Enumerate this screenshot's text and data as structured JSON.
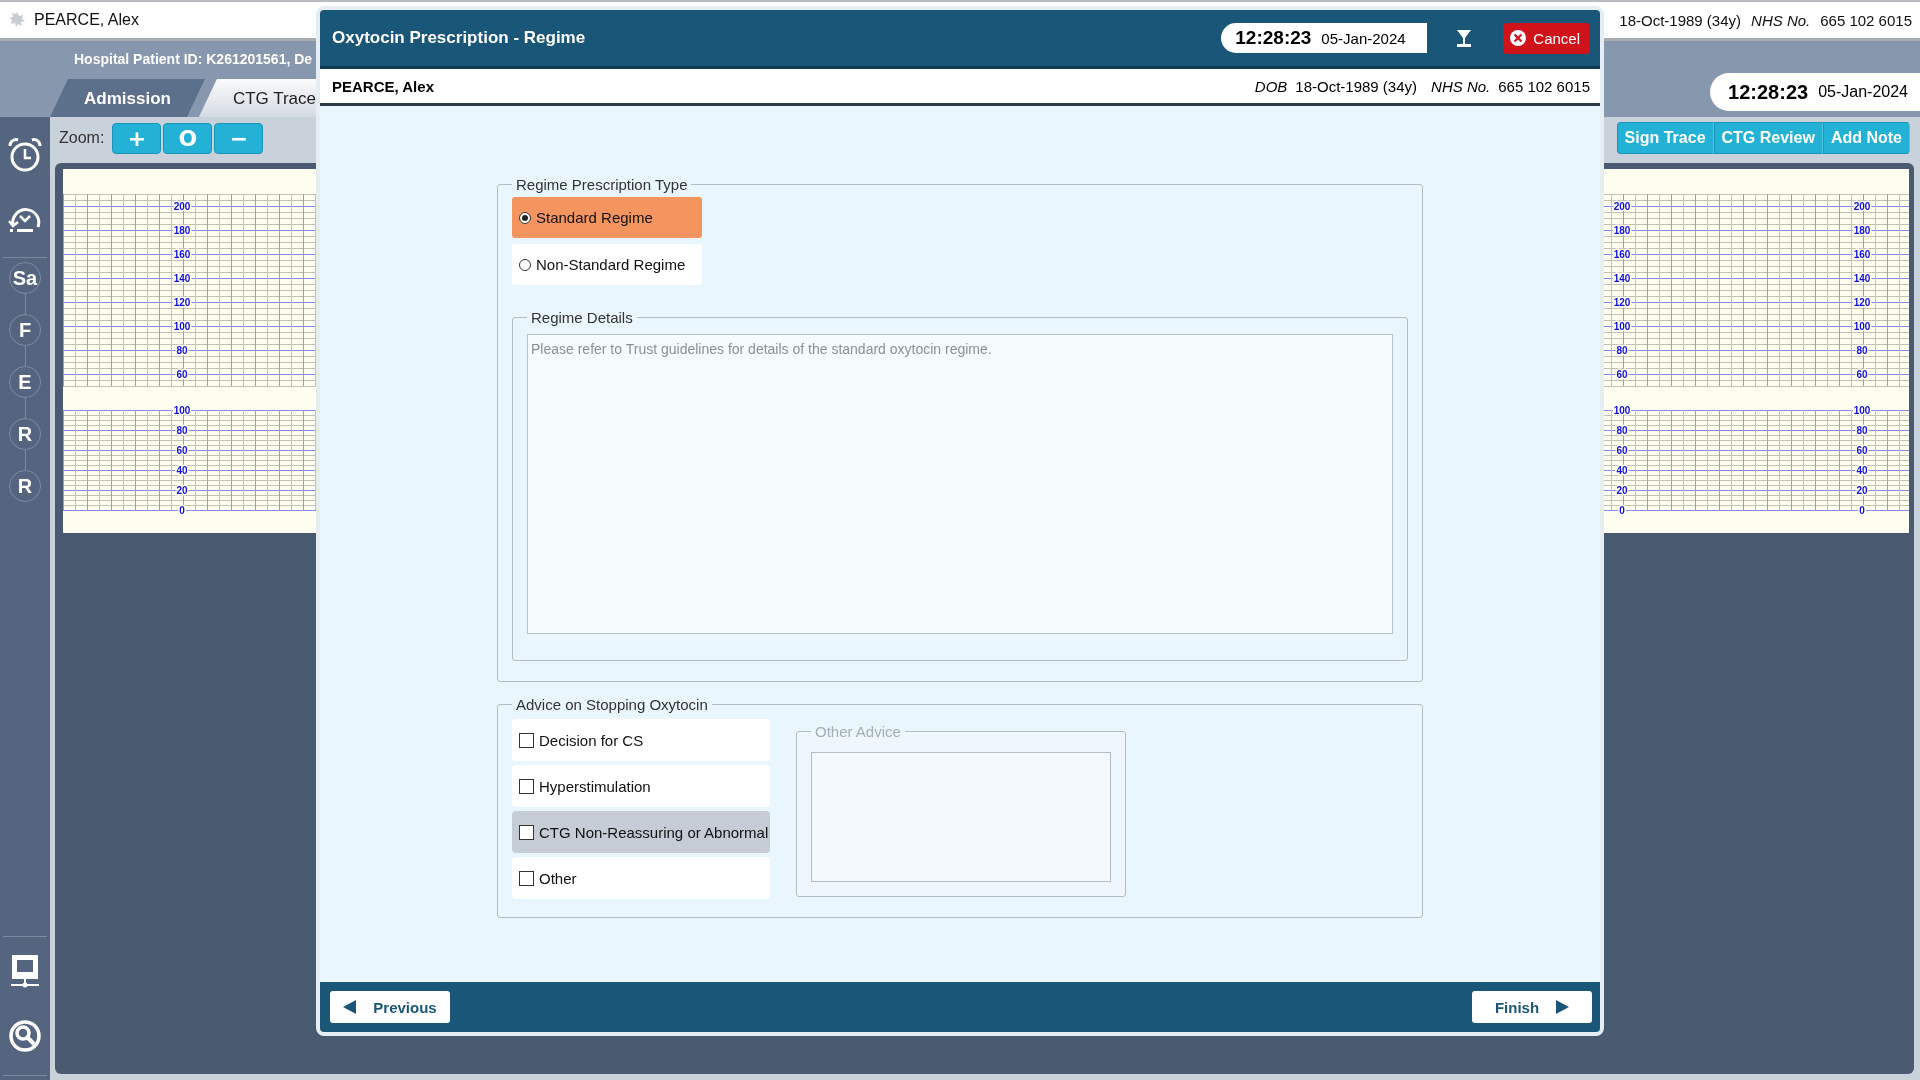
{
  "top_bar": {
    "patient_name": "PEARCE, Alex",
    "dob": "18-Oct-1989 (34y)",
    "nhs_label": "NHS No.",
    "nhs_number": "665 102 6015"
  },
  "header": {
    "patient_id_line": "Hospital Patient ID: K261201561, De",
    "tabs": [
      {
        "label": "Admission",
        "selected": false
      },
      {
        "label": "CTG Trace",
        "selected": true
      }
    ],
    "clock": {
      "time": "12:28:23",
      "date": "05-Jan-2024"
    }
  },
  "sidebar": {
    "stages": [
      "Sa",
      "F",
      "E",
      "R",
      "R"
    ]
  },
  "toolbar": {
    "zoom_label": "Zoom:",
    "zoom_buttons": [
      "+",
      "O",
      "−"
    ],
    "actions": [
      "Sign Trace",
      "CTG Review",
      "Add Note"
    ]
  },
  "ctg_grid": {
    "scale_columns": [
      {
        "fhr": [
          "200",
          "180",
          "160",
          "140",
          "120",
          "100",
          "80",
          "60"
        ],
        "toco": [
          "100",
          "80",
          "60",
          "40",
          "20",
          "0"
        ]
      },
      {
        "fhr": [
          "200",
          "180",
          "160",
          "140",
          "120",
          "100",
          "80",
          "60"
        ],
        "toco": [
          "100",
          "80",
          "60",
          "40",
          "20",
          "0"
        ]
      },
      {
        "fhr": [
          "200",
          "180",
          "160",
          "140",
          "120",
          "100",
          "80",
          "60"
        ],
        "toco": [
          "100",
          "80",
          "60",
          "40",
          "20",
          "0"
        ]
      }
    ]
  },
  "dialog": {
    "title": "Oxytocin Prescription - Regime",
    "clock": {
      "time": "12:28:23",
      "date": "05-Jan-2024"
    },
    "cancel_label": "Cancel",
    "patient": {
      "name": "PEARCE, Alex",
      "dob_label": "DOB",
      "dob": "18-Oct-1989 (34y)",
      "nhs_label": "NHS No.",
      "nhs_number": "665 102 6015"
    },
    "regime_type": {
      "legend": "Regime Prescription Type",
      "options": [
        {
          "label": "Standard Regime",
          "selected": true
        },
        {
          "label": "Non-Standard Regime",
          "selected": false
        }
      ],
      "details": {
        "legend": "Regime Details",
        "placeholder": "Please refer to Trust guidelines for details of the standard oxytocin regime."
      }
    },
    "advice": {
      "legend": "Advice on Stopping Oxytocin",
      "options": [
        {
          "label": "Decision for CS",
          "checked": false,
          "highlighted": false
        },
        {
          "label": "Hyperstimulation",
          "checked": false,
          "highlighted": false
        },
        {
          "label": "CTG Non-Reassuring or Abnormal",
          "checked": false,
          "highlighted": true
        },
        {
          "label": "Other",
          "checked": false,
          "highlighted": false
        }
      ],
      "other_advice": {
        "legend": "Other Advice",
        "disabled": true
      }
    },
    "footer": {
      "previous": "Previous",
      "finish": "Finish"
    }
  }
}
